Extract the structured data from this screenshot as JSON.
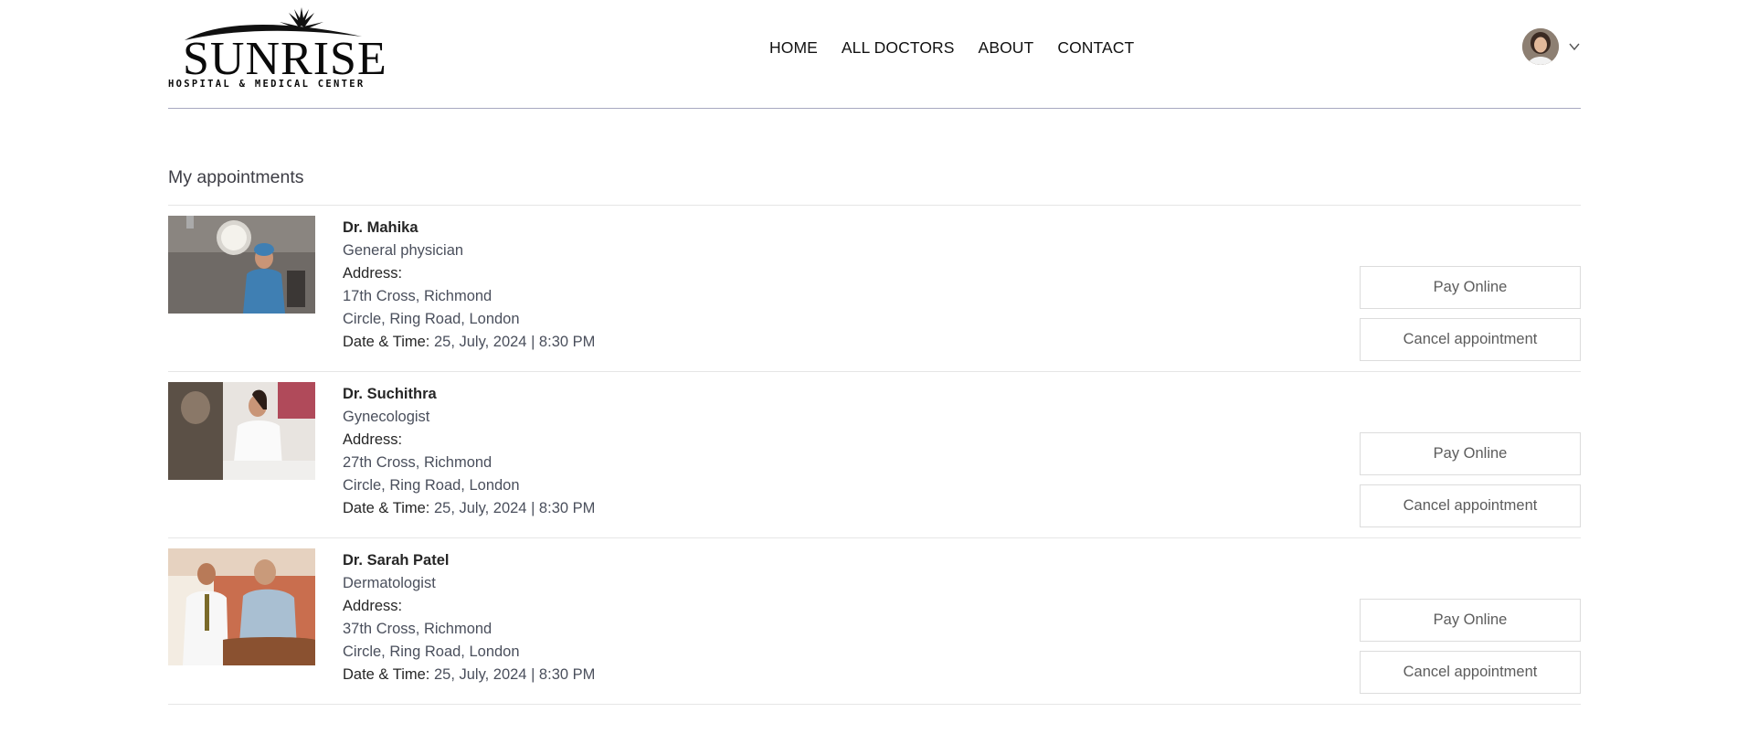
{
  "brand": {
    "name": "SUNRISE",
    "tagline": "HOSPITAL & MEDICAL CENTER"
  },
  "nav": {
    "items": [
      "HOME",
      "ALL DOCTORS",
      "ABOUT",
      "CONTACT"
    ]
  },
  "profile": {
    "avatar_icon": "user-avatar",
    "menu_icon": "chevron-down-icon"
  },
  "page": {
    "title": "My appointments"
  },
  "appointments": [
    {
      "name": "Dr. Mahika",
      "speciality": "General physician",
      "address_label": "Address:",
      "address_line1": "17th Cross, Richmond",
      "address_line2": "Circle, Ring Road, London",
      "datetime_label": "Date & Time:",
      "datetime": "25, July, 2024 | 8:30 PM",
      "pay_label": "Pay Online",
      "cancel_label": "Cancel appointment"
    },
    {
      "name": "Dr. Suchithra",
      "speciality": "Gynecologist",
      "address_label": "Address:",
      "address_line1": "27th Cross, Richmond",
      "address_line2": "Circle, Ring Road, London",
      "datetime_label": "Date & Time:",
      "datetime": "25, July, 2024 | 8:30 PM",
      "pay_label": "Pay Online",
      "cancel_label": "Cancel appointment"
    },
    {
      "name": "Dr. Sarah Patel",
      "speciality": "Dermatologist",
      "address_label": "Address:",
      "address_line1": "37th Cross, Richmond",
      "address_line2": "Circle, Ring Road, London",
      "datetime_label": "Date & Time:",
      "datetime": "25, July, 2024 | 8:30 PM",
      "pay_label": "Pay Online",
      "cancel_label": "Cancel appointment"
    }
  ]
}
